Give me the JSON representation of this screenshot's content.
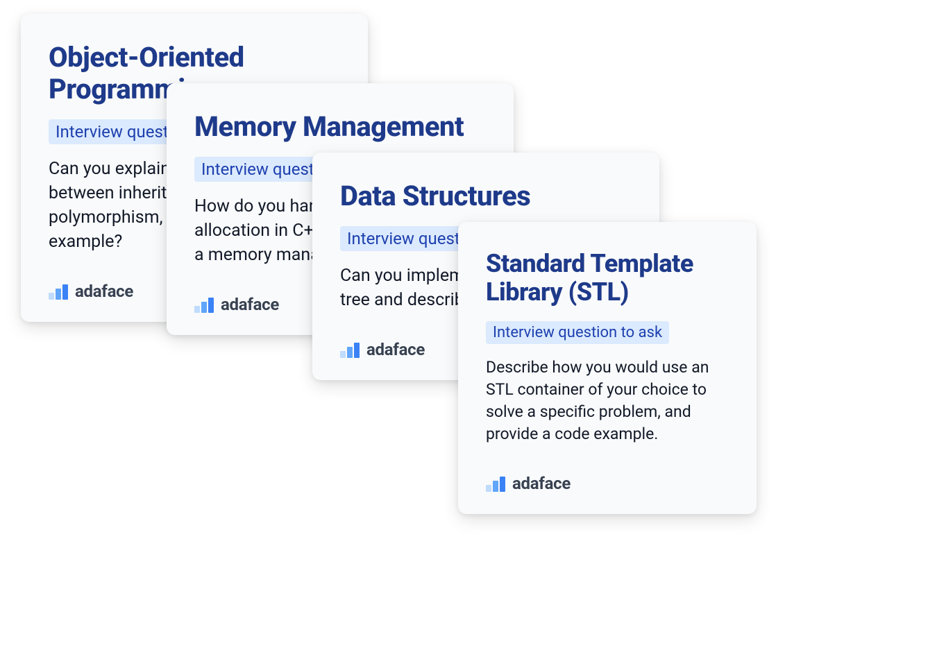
{
  "cards": [
    {
      "title": "Object-Oriented Programming",
      "subtitle": "Interview question to ask",
      "question": "Can you explain the difference between inheritance and polymorphism, and provide an example?",
      "brand": "adaface"
    },
    {
      "title": "Memory Management",
      "subtitle": "Interview question to ask",
      "question": "How do you handle memory allocation in C++? Give an example of a memory management bug?",
      "brand": "adaface"
    },
    {
      "title": "Data Structures",
      "subtitle": "Interview question to ask",
      "question": "Can you implement a binary search tree and describe its applications?",
      "brand": "adaface"
    },
    {
      "title": "Standard Template Library (STL)",
      "subtitle": "Interview question to ask",
      "question": "Describe how you would use an STL container of your choice to solve a specific problem, and provide a code example.",
      "brand": "adaface"
    }
  ]
}
